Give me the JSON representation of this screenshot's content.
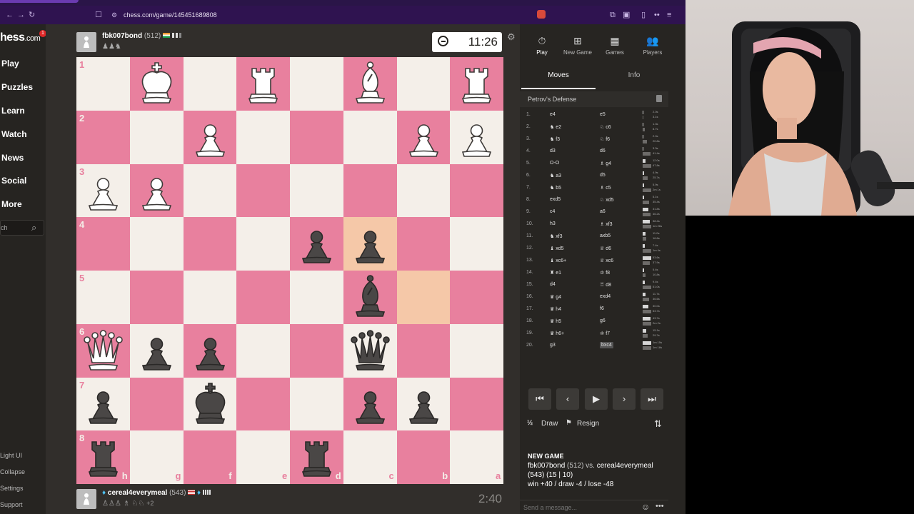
{
  "browser": {
    "url": "chess.com/game/145451689808",
    "accent": "#2f1350"
  },
  "sidebar": {
    "logo": "hess",
    "logo_suffix": ".com",
    "badge": "1",
    "items": [
      {
        "label": "Play"
      },
      {
        "label": "Puzzles"
      },
      {
        "label": "Learn"
      },
      {
        "label": "Watch"
      },
      {
        "label": "News"
      },
      {
        "label": "Social"
      },
      {
        "label": "More"
      }
    ],
    "search_value": "ch",
    "footer": [
      {
        "label": "Light UI"
      },
      {
        "label": "Collapse"
      },
      {
        "label": "Settings"
      },
      {
        "label": "Support"
      }
    ]
  },
  "players": {
    "top": {
      "name": "fbk007bond",
      "rating": "(512)",
      "clock": "11:26"
    },
    "bottom": {
      "name": "cereal4everymeal",
      "rating": "(543)",
      "clock": "2:40",
      "extra": "+2"
    }
  },
  "board": {
    "ranks": [
      "1",
      "2",
      "3",
      "4",
      "5",
      "6",
      "7",
      "8"
    ],
    "files": [
      "h",
      "g",
      "f",
      "e",
      "d",
      "c",
      "b",
      "a"
    ],
    "pieces": [
      {
        "row": 0,
        "col": 1,
        "type": "K",
        "color": "w"
      },
      {
        "row": 0,
        "col": 3,
        "type": "R",
        "color": "w"
      },
      {
        "row": 0,
        "col": 5,
        "type": "B",
        "color": "w"
      },
      {
        "row": 0,
        "col": 7,
        "type": "R",
        "color": "w"
      },
      {
        "row": 1,
        "col": 2,
        "type": "P",
        "color": "w"
      },
      {
        "row": 1,
        "col": 6,
        "type": "P",
        "color": "w"
      },
      {
        "row": 1,
        "col": 7,
        "type": "P",
        "color": "w"
      },
      {
        "row": 2,
        "col": 0,
        "type": "P",
        "color": "w"
      },
      {
        "row": 2,
        "col": 1,
        "type": "P",
        "color": "w"
      },
      {
        "row": 3,
        "col": 4,
        "type": "P",
        "color": "b"
      },
      {
        "row": 3,
        "col": 5,
        "type": "P",
        "color": "b"
      },
      {
        "row": 4,
        "col": 5,
        "type": "B",
        "color": "b"
      },
      {
        "row": 5,
        "col": 0,
        "type": "Q",
        "color": "w"
      },
      {
        "row": 5,
        "col": 1,
        "type": "P",
        "color": "b"
      },
      {
        "row": 5,
        "col": 2,
        "type": "P",
        "color": "b"
      },
      {
        "row": 5,
        "col": 5,
        "type": "Q",
        "color": "b"
      },
      {
        "row": 6,
        "col": 0,
        "type": "P",
        "color": "b"
      },
      {
        "row": 6,
        "col": 2,
        "type": "K",
        "color": "b"
      },
      {
        "row": 6,
        "col": 5,
        "type": "P",
        "color": "b"
      },
      {
        "row": 6,
        "col": 6,
        "type": "P",
        "color": "b"
      },
      {
        "row": 7,
        "col": 0,
        "type": "R",
        "color": "b"
      },
      {
        "row": 7,
        "col": 4,
        "type": "R",
        "color": "b"
      }
    ],
    "highlights": [
      {
        "row": 3,
        "col": 5
      },
      {
        "row": 4,
        "col": 6
      }
    ],
    "light_color": "#f4efe9",
    "dark_color": "#e8809e"
  },
  "panel": {
    "top_buttons": [
      {
        "label": "Play"
      },
      {
        "label": "New Game"
      },
      {
        "label": "Games"
      },
      {
        "label": "Players"
      }
    ],
    "tabs": [
      {
        "label": "Moves"
      },
      {
        "label": "Info"
      }
    ],
    "opening": "Petrov's Defense",
    "moves": [
      {
        "n": "1.",
        "w": "e4",
        "b": "e5",
        "tw": "2.0s",
        "tb": "3.1s",
        "fw": 0.08,
        "fb": 0.1
      },
      {
        "n": "2.",
        "w": "♞ e2",
        "b": "♘ c6",
        "tw": "1.3s",
        "tb": "8.7s",
        "fw": 0.05,
        "fb": 0.25
      },
      {
        "n": "3.",
        "w": "♞ f3",
        "b": "♘ f6",
        "tw": "2.0s",
        "tb": "20.8s",
        "fw": 0.08,
        "fb": 0.5
      },
      {
        "n": "4.",
        "w": "d3",
        "b": "d6",
        "tw": "3.3s",
        "tb": "41.4s",
        "fw": 0.1,
        "fb": 0.9
      },
      {
        "n": "5.",
        "w": "O-O",
        "b": "♗ g4",
        "tw": "12.0s",
        "tb": "47.8s",
        "fw": 0.35,
        "fb": 1.0
      },
      {
        "n": "6.",
        "w": "♞ a3",
        "b": "d5",
        "tw": "4.9s",
        "tb": "25.7s",
        "fw": 0.15,
        "fb": 0.55
      },
      {
        "n": "7.",
        "w": "♞ b5",
        "b": "♗ c5",
        "tw": "5.9s",
        "tb": "2m 1s",
        "fw": 0.18,
        "fb": 1.0
      },
      {
        "n": "8.",
        "w": "exd5",
        "b": "♘ xd5",
        "tw": "5.1s",
        "tb": "35.4s",
        "fw": 0.16,
        "fb": 0.75
      },
      {
        "n": "9.",
        "w": "c4",
        "b": "a6",
        "tw": "31.8s",
        "tb": "46.2s",
        "fw": 0.7,
        "fb": 0.95
      },
      {
        "n": "10.",
        "w": "h3",
        "b": "♗ xf3",
        "tw": "38.4s",
        "tb": "1m 26s",
        "fw": 0.85,
        "fb": 1.0
      },
      {
        "n": "11.",
        "w": "♞ xf3",
        "b": "axb5",
        "tw": "11.0s",
        "tb": "16.6s",
        "fw": 0.3,
        "fb": 0.4
      },
      {
        "n": "12.",
        "w": "♝ xd5",
        "b": "♕ d6",
        "tw": "7.4s",
        "tb": "1m 4s",
        "fw": 0.22,
        "fb": 1.0
      },
      {
        "n": "13.",
        "w": "♝ xc6+",
        "b": "♕ xc6",
        "tw": "53.6s",
        "tb": "37.9s",
        "fw": 1.0,
        "fb": 0.8
      },
      {
        "n": "14.",
        "w": "♜ e1",
        "b": "♔ f8",
        "tw": "5.4s",
        "tb": "10.8s",
        "fw": 0.16,
        "fb": 0.3
      },
      {
        "n": "15.",
        "w": "d4",
        "b": "♖ d8",
        "tw": "9.4s",
        "tb": "51.0s",
        "fw": 0.28,
        "fb": 1.0
      },
      {
        "n": "16.",
        "w": "♛ g4",
        "b": "exd4",
        "tw": "11.7s",
        "tb": "36.6s",
        "fw": 0.32,
        "fb": 0.78
      },
      {
        "n": "17.",
        "w": "♛ h4",
        "b": "f6",
        "tw": "30.0s",
        "tb": "53.7s",
        "fw": 0.65,
        "fb": 1.0
      },
      {
        "n": "18.",
        "w": "♛ h5",
        "b": "g6",
        "tw": "43.7s",
        "tb": "2m 2s",
        "fw": 0.9,
        "fb": 1.0
      },
      {
        "n": "19.",
        "w": "♛ h6+",
        "b": "♔ f7",
        "tw": "15.1s",
        "tb": "29.7s",
        "fw": 0.4,
        "fb": 0.62
      },
      {
        "n": "20.",
        "w": "g3",
        "b": "bxc4",
        "tw": "1m 15s",
        "tb": "1m 18s",
        "fw": 1.0,
        "fb": 1.0
      }
    ],
    "draw_label": "Draw",
    "resign_label": "Resign",
    "chat": {
      "title": "NEW GAME",
      "line1_a": "fbk007bond",
      "line1_b": " (512) vs. ",
      "line1_c": "cereal4everymeal",
      "line2": "(543) (15 | 10)",
      "line3": "win +40 / draw -4 / lose -48"
    },
    "message_placeholder": "Send a message..."
  }
}
